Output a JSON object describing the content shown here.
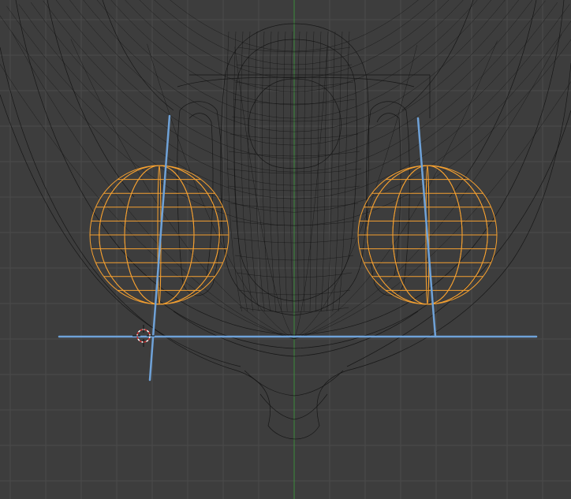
{
  "viewport": {
    "background_color": "#3d3d3d",
    "grid_color": "#4a4a4a",
    "y_axis_color": "#3c8c3c",
    "wireframe_color": "#101010",
    "selected_color": "#f5a030",
    "guide_line_color": "#6fa2d8",
    "cursor_colors": [
      "#d93030",
      "#ffffff"
    ]
  },
  "objects": [
    {
      "name": "head-mesh",
      "selected": false
    },
    {
      "name": "eye-left",
      "selected": true
    },
    {
      "name": "eye-right",
      "selected": true
    }
  ],
  "icons": {
    "cursor": "3d-cursor-icon"
  }
}
